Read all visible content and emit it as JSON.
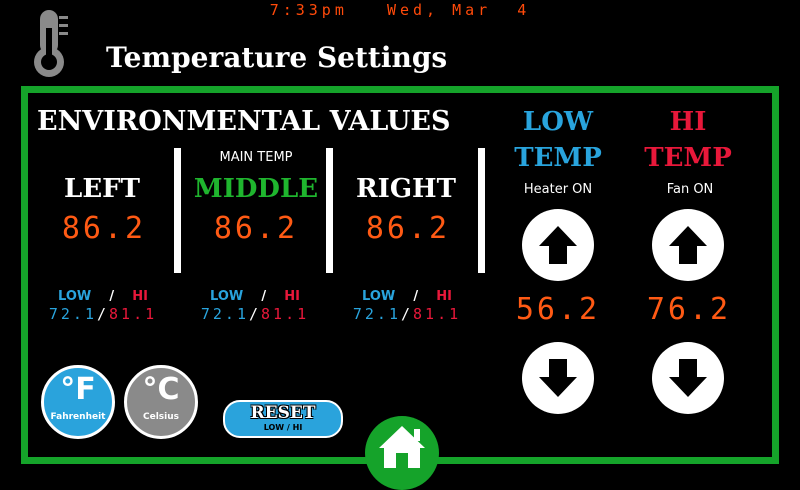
{
  "header": {
    "clock": "7:33pm   Wed, Mar  4",
    "title": "Temperature Settings",
    "icon": "thermometer-icon"
  },
  "environmental": {
    "title": "ENVIRONMENTAL VALUES",
    "zones": [
      {
        "caption": "",
        "label": "LEFT",
        "value": "86.2",
        "low_label": "LOW",
        "hi_label": "HI",
        "low": "72.1",
        "hi": "81.1"
      },
      {
        "caption": "MAIN TEMP",
        "label": "MIDDLE",
        "value": "86.2",
        "low_label": "LOW",
        "hi_label": "HI",
        "low": "72.1",
        "hi": "81.1"
      },
      {
        "caption": "",
        "label": "RIGHT",
        "value": "86.2",
        "low_label": "LOW",
        "hi_label": "HI",
        "low": "72.1",
        "hi": "81.1"
      }
    ],
    "separator": "/"
  },
  "low_temp": {
    "title_1": "LOW",
    "title_2": "TEMP",
    "status": "Heater ON",
    "value": "56.2",
    "up_icon": "arrow-up-icon",
    "down_icon": "arrow-down-icon"
  },
  "hi_temp": {
    "title_1": "HI",
    "title_2": "TEMP",
    "status": "Fan ON",
    "value": "76.2",
    "up_icon": "arrow-up-icon",
    "down_icon": "arrow-down-icon"
  },
  "units": {
    "fahrenheit_symbol": "°F",
    "fahrenheit_label": "Fahrenheit",
    "celsius_symbol": "°C",
    "celsius_label": "Celsius"
  },
  "reset": {
    "label": "RESET",
    "sublabel": "LOW / HI"
  },
  "home": {
    "icon": "home-icon"
  },
  "colors": {
    "frame_green": "#15a32a",
    "value_orange": "#ff5a14",
    "low_blue": "#29a4dd",
    "hi_red": "#e8183a",
    "fahrenheit_active": "#2aa3dc",
    "celsius_inactive": "#8a8a8a"
  }
}
